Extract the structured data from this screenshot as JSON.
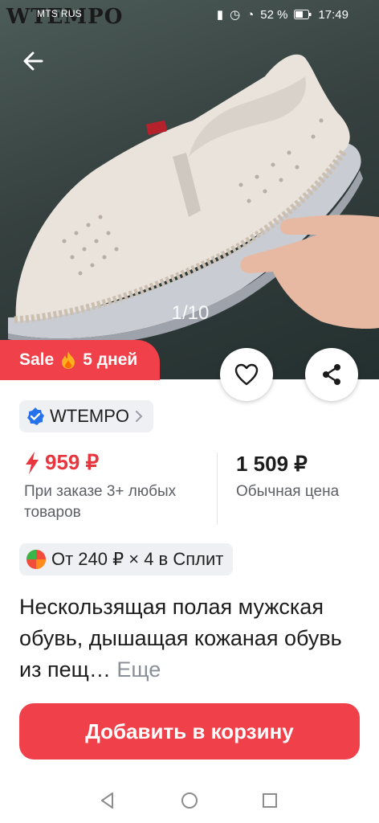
{
  "status_bar": {
    "carrier": "MTS RUS",
    "battery_percent": "52 %",
    "time": "17:49",
    "watermark": "WTEMPO"
  },
  "gallery": {
    "counter": "1/10"
  },
  "sale_badge": {
    "label": "Sale",
    "duration": "5 дней"
  },
  "seller": {
    "name": "WTEMPO"
  },
  "price": {
    "promo": "959 ₽",
    "promo_note": "При заказе 3+ любых товаров",
    "regular": "1 509 ₽",
    "regular_note": "Обычная цена"
  },
  "split": {
    "text": "От 240 ₽ × 4 в Сплит"
  },
  "product": {
    "title": "Нескользящая полая мужская обувь, дышащая кожаная обувь из пещ…",
    "more_label": "Еще"
  },
  "cart_button": {
    "label": "Добавить в корзину"
  },
  "colors": {
    "accent": "#f0404a",
    "price_red": "#e8363f"
  }
}
